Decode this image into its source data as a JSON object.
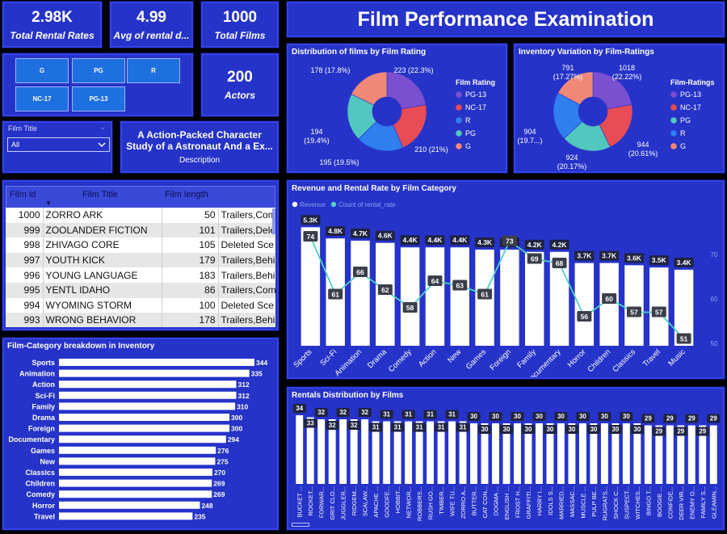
{
  "title": "Film Performance Examination",
  "kpis": {
    "rental_rates": {
      "value": "2.98K",
      "label": "Total Rental Rates"
    },
    "avg_rental": {
      "value": "4.99",
      "label": "Avg of rental d..."
    },
    "total_films": {
      "value": "1000",
      "label": "Total Films"
    },
    "actors": {
      "value": "200",
      "label": "Actors"
    }
  },
  "rating_buttons": [
    "G",
    "PG",
    "R",
    "NC-17",
    "PG-13"
  ],
  "film_title_slicer": {
    "label": "Film Title",
    "value": "All"
  },
  "description_card": {
    "text": "A Action-Packed Character Study of a Astronaut And a Ex...",
    "label": "Description"
  },
  "film_table": {
    "columns": [
      "Film id",
      "Film Title",
      "Film length",
      ""
    ],
    "rows": [
      [
        "1000",
        "ZORRO ARK",
        "50",
        "Trailers,Com"
      ],
      [
        "999",
        "ZOOLANDER FICTION",
        "101",
        "Trailers,Dele"
      ],
      [
        "998",
        "ZHIVAGO CORE",
        "105",
        "Deleted Sce"
      ],
      [
        "997",
        "YOUTH KICK",
        "179",
        "Trailers,Behi"
      ],
      [
        "996",
        "YOUNG LANGUAGE",
        "183",
        "Trailers,Behi"
      ],
      [
        "995",
        "YENTL IDAHO",
        "86",
        "Trailers,Com"
      ],
      [
        "994",
        "WYOMING STORM",
        "100",
        "Deleted Sce"
      ],
      [
        "993",
        "WRONG BEHAVIOR",
        "178",
        "Trailers,Behi"
      ]
    ]
  },
  "chart_data": [
    {
      "type": "pie",
      "title": "Distribution of films by Film Rating",
      "legend_title": "Film Rating",
      "legend_position": "right",
      "slices": [
        {
          "name": "PG-13",
          "value": 223,
          "label": "223 (22.3%)",
          "color": "#7a4fd0"
        },
        {
          "name": "NC-17",
          "value": 210,
          "label": "210 (21%)",
          "color": "#e84c55"
        },
        {
          "name": "R",
          "value": 195,
          "label": "195 (19.5%)",
          "color": "#2f7ff0"
        },
        {
          "name": "PG",
          "value": 194,
          "label": "194 (19.4%)",
          "color": "#52c7c0"
        },
        {
          "name": "G",
          "value": 178,
          "label": "178 (17.8%)",
          "color": "#f08878"
        }
      ]
    },
    {
      "type": "pie",
      "title": "Inventory Variation by Film-Ratings",
      "legend_title": "Film-Ratings",
      "legend_position": "right",
      "slices": [
        {
          "name": "PG-13",
          "value": 1018,
          "label": "1018 (22.22%)",
          "color": "#7a4fd0"
        },
        {
          "name": "NC-17",
          "value": 944,
          "label": "944 (20.61%)",
          "color": "#e84c55"
        },
        {
          "name": "PG",
          "value": 924,
          "label": "924 (20.17%)",
          "color": "#52c7c0"
        },
        {
          "name": "R",
          "value": 904,
          "label": "904 (19.7...)",
          "color": "#2f7ff0"
        },
        {
          "name": "G",
          "value": 791,
          "label": "791 (17.27%)",
          "color": "#f08878"
        }
      ]
    },
    {
      "type": "bar",
      "title": "Revenue and Rental Rate by Film Category",
      "legend": [
        "Revenue",
        "Count of rental_rate"
      ],
      "categories": [
        "Sports",
        "Sci-Fi",
        "Animation",
        "Drama",
        "Comedy",
        "Action",
        "New",
        "Games",
        "Foreign",
        "Family",
        "Documentary",
        "Horror",
        "Children",
        "Classics",
        "Travel",
        "Music"
      ],
      "series": [
        {
          "name": "Revenue",
          "values": [
            5300,
            4800,
            4700,
            4600,
            4400,
            4400,
            4400,
            4300,
            4300,
            4200,
            4200,
            3700,
            3700,
            3600,
            3500,
            3400
          ],
          "labels": [
            "5.3K",
            "4.8K",
            "4.7K",
            "4.6K",
            "4.4K",
            "4.4K",
            "4.4K",
            "4.3K",
            "4.3K",
            "4.2K",
            "4.2K",
            "3.7K",
            "3.7K",
            "3.6K",
            "3.5K",
            "3.4K"
          ],
          "color": "#ffffff"
        },
        {
          "name": "Count of rental_rate",
          "values": [
            74,
            61,
            66,
            62,
            58,
            64,
            63,
            61,
            73,
            69,
            68,
            56,
            60,
            57,
            57,
            51
          ],
          "color": "#4fd1c5"
        }
      ],
      "y2_ticks": [
        70,
        60,
        50
      ],
      "y2lim": [
        50,
        78
      ]
    },
    {
      "type": "bar",
      "title": "Film-Category breakdown in Inventory",
      "orientation": "horizontal",
      "categories": [
        "Sports",
        "Animation",
        "Action",
        "Sci-Fi",
        "Family",
        "Drama",
        "Foreign",
        "Documentary",
        "Games",
        "New",
        "Classics",
        "Children",
        "Comedy",
        "Horror",
        "Travel"
      ],
      "values": [
        344,
        335,
        312,
        312,
        310,
        300,
        300,
        294,
        276,
        275,
        270,
        269,
        269,
        248,
        235
      ],
      "xlim": [
        0,
        344
      ]
    },
    {
      "type": "bar",
      "title": "Rentals Distribution by Films",
      "categories": [
        "BUCKET ...",
        "ROCKET...",
        "FORWAR...",
        "GRIT CLO...",
        "JUGGLER...",
        "RIDGEM...",
        "SCALAW...",
        "APACHE ...",
        "GOODFE...",
        "HOBBIT...",
        "NETWOR...",
        "ROBBERS...",
        "RUSH GO...",
        "TIMBER...",
        "WIFE TU...",
        "ZORRO A...",
        "BUTTER...",
        "CAT CON...",
        "DOGMA ...",
        "ENGLISH ...",
        "FROST H...",
        "GRAFFITI...",
        "HARRY I...",
        "IDOLS S...",
        "MARRIED...",
        "MASSAC...",
        "MUSCLE ...",
        "PULP BE...",
        "RUGRATS...",
        "SHOCK C...",
        "SUSPECT...",
        "WITCHES...",
        "BINGO T...",
        "BOOGIE ...",
        "CONFIDE...",
        "DEER VIR...",
        "ENEMY O...",
        "FAMILY S...",
        "GLEAMIN..."
      ],
      "values": [
        34,
        33,
        32,
        32,
        32,
        32,
        32,
        31,
        31,
        31,
        31,
        31,
        31,
        31,
        31,
        31,
        30,
        30,
        30,
        30,
        30,
        30,
        30,
        30,
        30,
        30,
        30,
        30,
        30,
        30,
        30,
        30,
        29,
        29,
        29,
        29,
        29,
        29,
        29
      ],
      "ylim": [
        0,
        36
      ]
    }
  ]
}
